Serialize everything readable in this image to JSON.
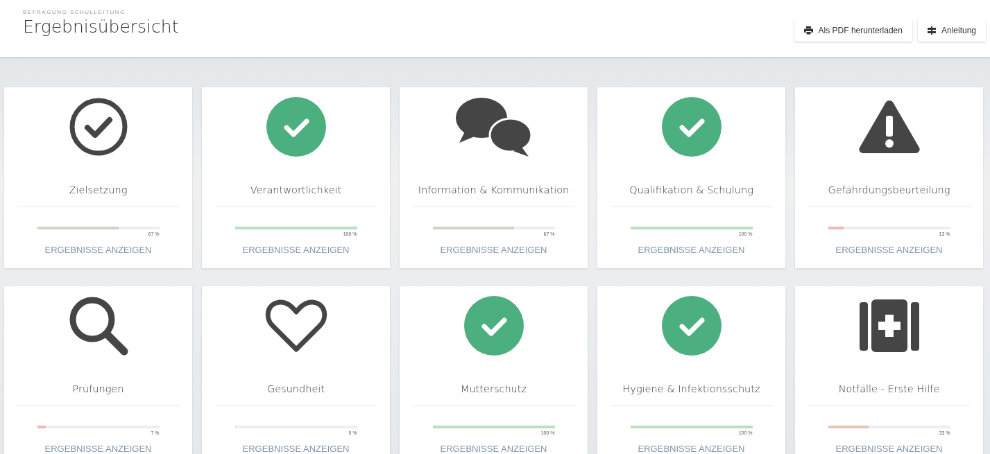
{
  "header": {
    "eyebrow": "BEFRAGUNG SCHULLEITUNG",
    "title": "Ergebnisübersicht",
    "buttons": [
      {
        "kind": "print",
        "label": "Als PDF herunterladen"
      },
      {
        "kind": "guide",
        "label": "Anleitung"
      }
    ]
  },
  "cards": [
    {
      "kind": "check-outline",
      "title": "Zielsetzung",
      "level": 0.67,
      "reading": "67 %",
      "color": "#d4d3c3",
      "link": "ERGEBNISSE ANZEIGEN"
    },
    {
      "kind": "check-green",
      "title": "Verantwortlichkeit",
      "level": 1,
      "reading": "100 %",
      "color": "#b8e0c1",
      "link": "ERGEBNISSE ANZEIGEN"
    },
    {
      "kind": "chat",
      "title": "Information & Kommunikation",
      "level": 0.67,
      "reading": "67 %",
      "color": "#d4d3c3",
      "link": "ERGEBNISSE ANZEIGEN"
    },
    {
      "kind": "check-green",
      "title": "Qualifikation & Schulung",
      "level": 1,
      "reading": "100 %",
      "color": "#b8e0c1",
      "link": "ERGEBNISSE ANZEIGEN"
    },
    {
      "kind": "warning",
      "title": "Gefährdungsbeurteilung",
      "level": 0.13,
      "reading": "13 %",
      "color": "#f0b7b7",
      "link": "ERGEBNISSE ANZEIGEN"
    },
    {
      "kind": "search",
      "title": "Prüfungen",
      "level": 0.07,
      "reading": "7 %",
      "color": "#f0b7b7",
      "link": "ERGEBNISSE ANZEIGEN"
    },
    {
      "kind": "heart",
      "title": "Gesundheit",
      "level": 0,
      "reading": "0 %",
      "link": "ERGEBNISSE ANZEIGEN"
    },
    {
      "kind": "check-green",
      "title": "Mutterschutz",
      "level": 1,
      "reading": "100 %",
      "color": "#b8e0c1",
      "link": "ERGEBNISSE ANZEIGEN"
    },
    {
      "kind": "check-green",
      "title": "Hygiene & Infektionsschutz",
      "level": 1,
      "reading": "100 %",
      "color": "#b8e0c1",
      "link": "ERGEBNISSE ANZEIGEN"
    },
    {
      "kind": "first-aid",
      "title": "Notfälle - Erste Hilfe",
      "level": 0.33,
      "reading": "33 %",
      "color": "#e8c3b6",
      "link": "ERGEBNISSE ANZEIGEN"
    }
  ]
}
